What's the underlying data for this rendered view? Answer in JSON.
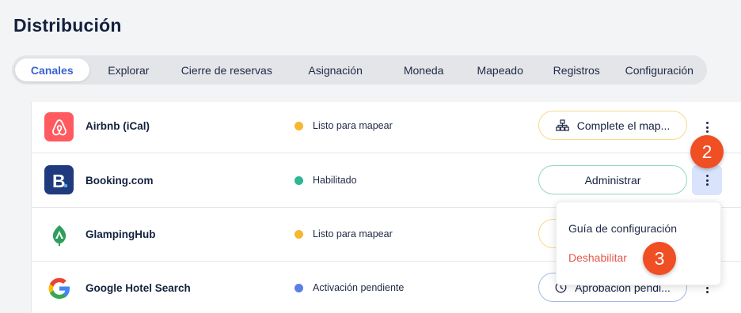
{
  "page": {
    "title": "Distribución"
  },
  "tabs": [
    {
      "label": "Canales",
      "active": true
    },
    {
      "label": "Explorar"
    },
    {
      "label": "Cierre de reservas"
    },
    {
      "label": "Asignación"
    },
    {
      "label": "Moneda"
    },
    {
      "label": "Mapeado"
    },
    {
      "label": "Registros"
    },
    {
      "label": "Configuración"
    }
  ],
  "channels": [
    {
      "name": "Airbnb (iCal)",
      "logo": "airbnb-logo",
      "status": "Listo para mapear",
      "status_color": "#f5b82e",
      "action": "Complete el map...",
      "action_icon": "sitemap-icon"
    },
    {
      "name": "Booking.com",
      "logo": "booking-logo",
      "status": "Habilitado",
      "status_color": "#2bb894",
      "action": "Administrar"
    },
    {
      "name": "GlampingHub",
      "logo": "glampinghub-logo",
      "status": "Listo para mapear",
      "status_color": "#f5b82e"
    },
    {
      "name": "Google Hotel Search",
      "logo": "google-logo",
      "status": "Activación pendiente",
      "status_color": "#5b7fe6",
      "action": "Aprobación pendi...",
      "action_icon": "clock-icon"
    }
  ],
  "context_menu": {
    "items": [
      "Guía de configuración",
      "Deshabilitar"
    ]
  },
  "annotations": [
    "2",
    "3"
  ],
  "colors": {
    "accent": "#3b63d4",
    "danger": "#e4574d",
    "badge": "#f04e23"
  }
}
